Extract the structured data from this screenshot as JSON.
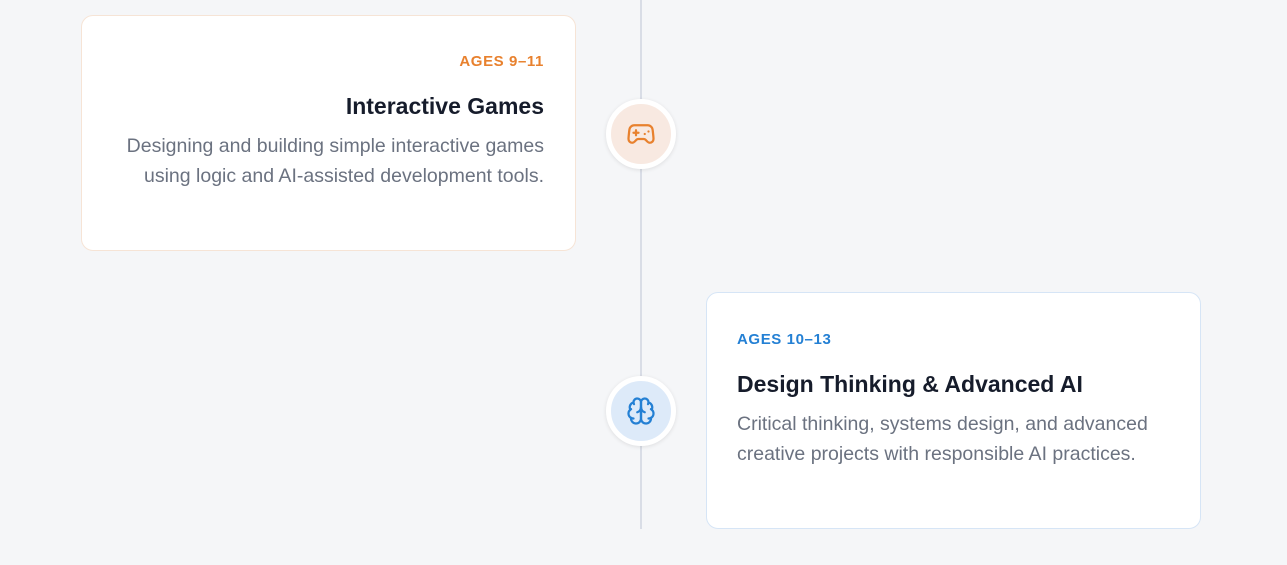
{
  "timeline": {
    "items": [
      {
        "age": "AGES 9–11",
        "title": "Interactive Games",
        "description": "Designing and building simple interactive games using logic and AI-assisted development tools.",
        "icon": "gamepad-icon",
        "accent": "#e8812e"
      },
      {
        "age": "AGES 10–13",
        "title": "Design Thinking & Advanced AI",
        "description": "Critical thinking, systems design, and advanced creative projects with responsible AI practices.",
        "icon": "brain-icon",
        "accent": "#2480d4"
      }
    ]
  }
}
